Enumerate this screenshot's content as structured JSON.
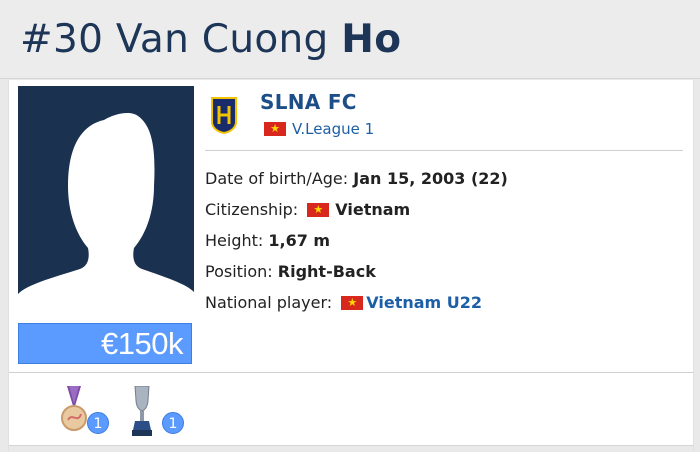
{
  "header": {
    "number": "#30",
    "first_names": "Van Cuong",
    "last_name": "Ho"
  },
  "player": {
    "market_value": "€150k",
    "photo_icon": "player-silhouette-icon"
  },
  "club": {
    "name": "SLNA FC",
    "league": "V.League 1",
    "logo_icon": "slna-club-logo-icon",
    "league_flag": "vietnam-flag-icon"
  },
  "details": [
    {
      "label": "Date of birth/Age:",
      "value": "Jan 15, 2003 (22)",
      "flag": false,
      "link": false
    },
    {
      "label": "Citizenship:",
      "value": "Vietnam",
      "flag": true,
      "link": false
    },
    {
      "label": "Height:",
      "value": "1,67 m",
      "flag": false,
      "link": false
    },
    {
      "label": "Position:",
      "value": "Right-Back",
      "flag": false,
      "link": false
    },
    {
      "label": "National player:",
      "value": "Vietnam U22",
      "flag": true,
      "link": true
    }
  ],
  "achievements": [
    {
      "icon": "medal-icon",
      "count": "1"
    },
    {
      "icon": "trophy-icon",
      "count": "1"
    }
  ],
  "colors": {
    "title": "#1d3557",
    "value_box": "#5b9bff",
    "link": "#1d5fa6",
    "flag_red": "#d8281e",
    "flag_star": "#ffd800"
  }
}
